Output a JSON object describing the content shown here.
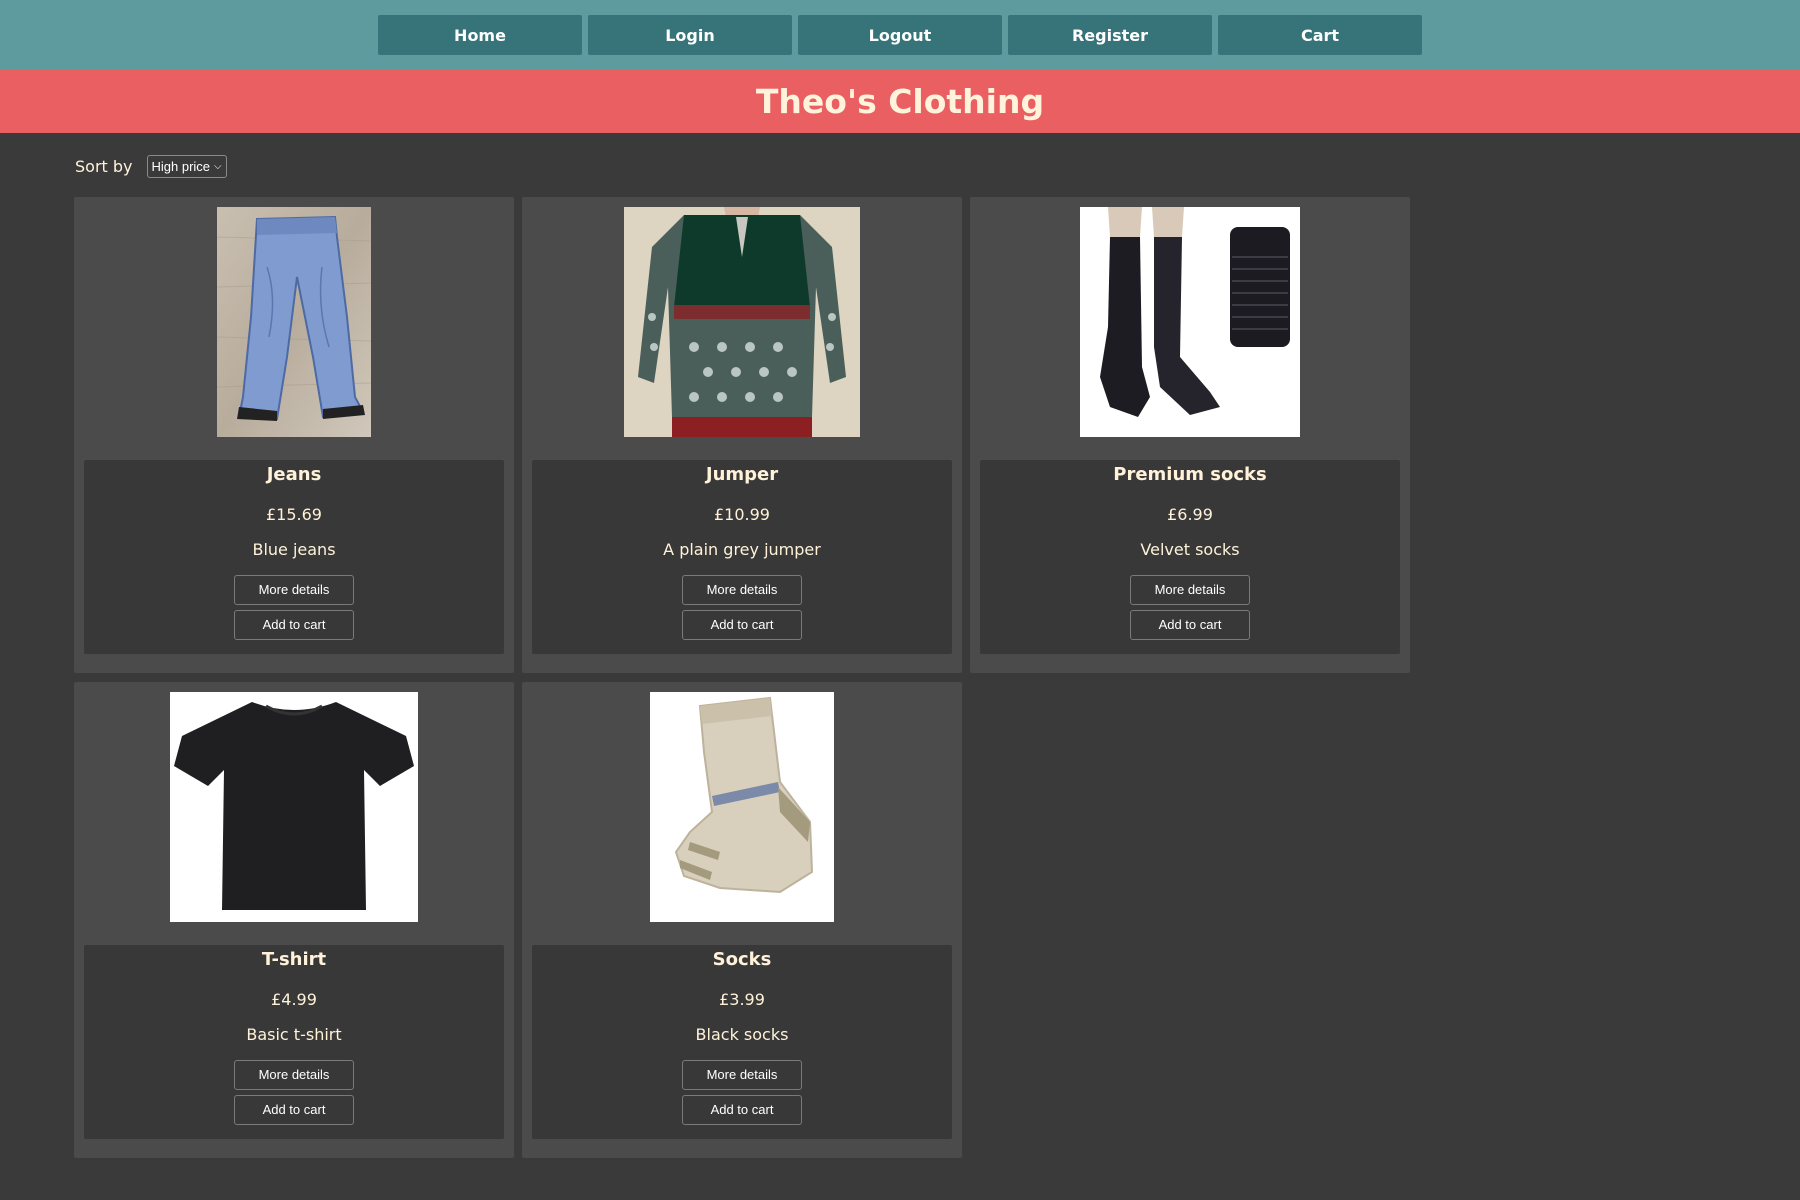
{
  "nav": {
    "items": [
      {
        "label": "Home"
      },
      {
        "label": "Login"
      },
      {
        "label": "Logout"
      },
      {
        "label": "Register"
      },
      {
        "label": "Cart"
      }
    ]
  },
  "site": {
    "title": "Theo's Clothing"
  },
  "sort": {
    "label": "Sort by",
    "selected": "High price"
  },
  "products": [
    {
      "name": "Jeans",
      "price": "£15.69",
      "desc": "Blue jeans",
      "details_label": "More details",
      "cart_label": "Add to cart",
      "icon": "jeans-photo"
    },
    {
      "name": "Jumper",
      "price": "£10.99",
      "desc": "A plain grey jumper",
      "details_label": "More details",
      "cart_label": "Add to cart",
      "icon": "jumper-photo"
    },
    {
      "name": "Premium socks",
      "price": "£6.99",
      "desc": "Velvet socks",
      "details_label": "More details",
      "cart_label": "Add to cart",
      "icon": "premium-socks-photo"
    },
    {
      "name": "T-shirt",
      "price": "£4.99",
      "desc": "Basic t-shirt",
      "details_label": "More details",
      "cart_label": "Add to cart",
      "icon": "tshirt-photo"
    },
    {
      "name": "Socks",
      "price": "£3.99",
      "desc": "Black socks",
      "details_label": "More details",
      "cart_label": "Add to cart",
      "icon": "socks-photo"
    }
  ],
  "colors": {
    "nav_bg": "#5e9b9f",
    "nav_button": "#37747a",
    "banner": "#e95f62",
    "page_bg": "#3a3a3a",
    "card_bg": "#4b4b4b",
    "info_bg": "#383838"
  }
}
